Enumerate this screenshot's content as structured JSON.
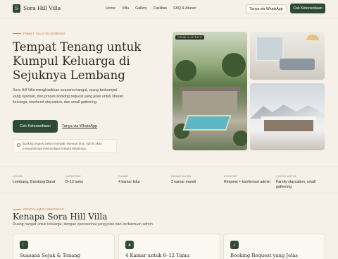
{
  "brand": {
    "logo_letter": "S",
    "name": "Sora Hill Villa"
  },
  "nav": {
    "menu": [
      "Home",
      "Villa",
      "Gallery",
      "Fasilitas",
      "FAQ & Aturan"
    ],
    "whatsapp_button": "Tanya via WhatsApp",
    "check_button": "Cek Ketersediaan"
  },
  "hero": {
    "eyebrow": "FAMILY VILLA IN LEMBANG",
    "title": "Tempat Tenang untuk Kumpul Keluarga di Sejuknya Lembang",
    "description": "Sora Hill Villa menghadirkan suasana hangat, ruang berkumpul yang nyaman, dan proses booking request yang jelas untuk liburan keluarga, weekend staycation, dan small gathering.",
    "primary_button": "Cek Ketersediaan",
    "secondary_link": "Tanya via WhatsApp",
    "note": "Booking request belum menjadi reservasi final. Admin akan mengonfirmasi ketersediaan melalui WhatsApp.",
    "photo_tag": "VISUAL ILUSTRATIF"
  },
  "info": [
    {
      "label": "LOKASI",
      "value": "Lembang, Bandung Barat"
    },
    {
      "label": "KAPASITAS",
      "value": "8–12 tamu"
    },
    {
      "label": "KAMAR",
      "value": "4 kamar tidur"
    },
    {
      "label": "KAMAR MANDI",
      "value": "3 kamar mandi"
    },
    {
      "label": "BOOKING",
      "value": "Request + konfirmasi admin"
    },
    {
      "label": "COCOK UNTUK",
      "value": "Family staycation, small gathering"
    }
  ],
  "why": {
    "eyebrow": "PENGALAMAN MENGINAP",
    "title": "Kenapa Sora Hill Villa",
    "subtitle": "Ruang hangat untuk keluarga, dengan operasional yang jelas dan berbantuan admin.",
    "cards": [
      {
        "icon": "moon-icon",
        "glyph": "☾",
        "title": "Suasana Sejuk & Tenang"
      },
      {
        "icon": "mountain-icon",
        "glyph": "▲",
        "title": "4 Kamar untuk 8–12 Tamu"
      },
      {
        "icon": "check-icon",
        "glyph": "✓",
        "title": "Booking Request yang Jelas"
      }
    ]
  },
  "colors": {
    "accent": "#2f4a34",
    "eyebrow": "#b47a3f",
    "background": "#f6f1e8"
  }
}
